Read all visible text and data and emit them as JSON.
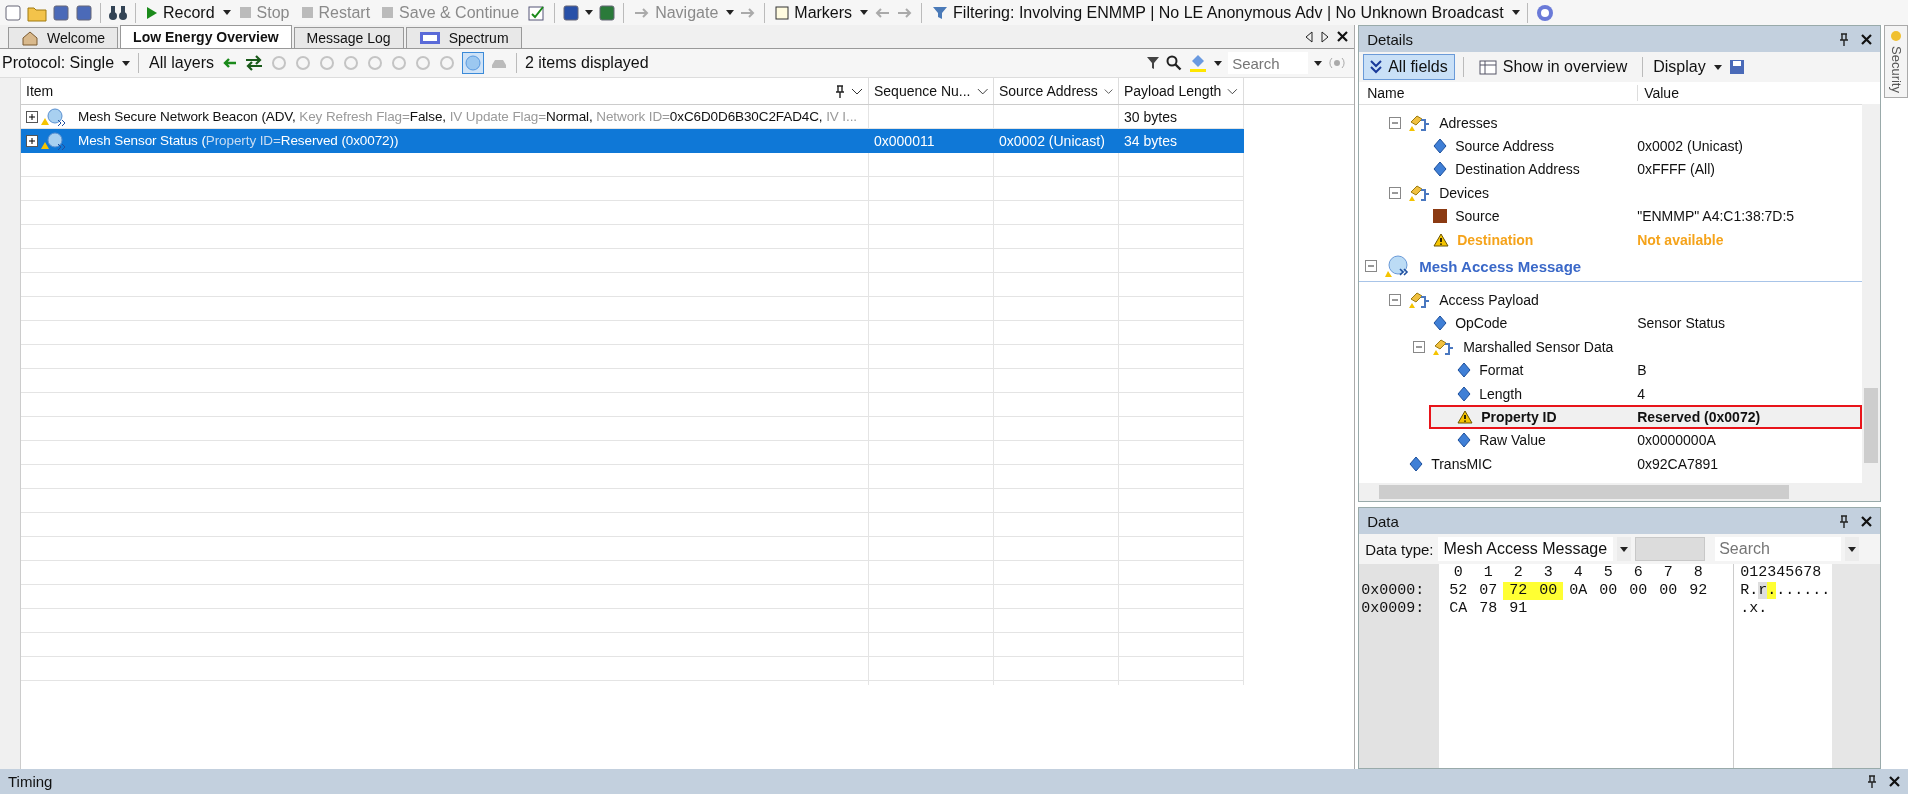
{
  "toolbar": {
    "buttons": [
      {
        "label": "Record",
        "disabled": false,
        "dropdown": true
      },
      {
        "label": "Stop",
        "disabled": true,
        "dropdown": false
      },
      {
        "label": "Restart",
        "disabled": true,
        "dropdown": false
      },
      {
        "label": "Save & Continue",
        "disabled": true,
        "dropdown": false
      },
      {
        "label": "Navigate",
        "disabled": true,
        "dropdown": true
      },
      {
        "label": "Markers",
        "disabled": false,
        "dropdown": true
      },
      {
        "label": "Filtering: Involving ENMMP | No LE Anonymous Adv | No Unknown Broadcast",
        "disabled": false,
        "dropdown": true
      }
    ]
  },
  "tabs": [
    {
      "label": "Welcome",
      "selected": false
    },
    {
      "label": "Low Energy Overview",
      "selected": true
    },
    {
      "label": "Message Log",
      "selected": false
    },
    {
      "label": "Spectrum",
      "selected": false
    }
  ],
  "filter_bar": {
    "protocol": "Protocol: Single",
    "layers": "All layers",
    "count": "2 items displayed",
    "search": {
      "placeholder": "Search"
    }
  },
  "table": {
    "columns": [
      "Item",
      "Sequence Nu...",
      "Source Address",
      "Payload Length"
    ],
    "rows": [
      {
        "item": [
          {
            "text": "Mesh Secure Network Beacon (ADV, ",
            "dim": false
          },
          {
            "text": "Key Refresh Flag=",
            "dim": true
          },
          {
            "text": "False, ",
            "dim": false
          },
          {
            "text": "IV Update Flag=",
            "dim": true
          },
          {
            "text": "Normal, ",
            "dim": false
          },
          {
            "text": "Network ID=",
            "dim": true
          },
          {
            "text": "0xC6D0D6B30C2FAD4C, ",
            "dim": false
          },
          {
            "text": "IV I...",
            "dim": true
          }
        ],
        "sequence": "",
        "source": "",
        "payload": "30 bytes",
        "selected": false
      },
      {
        "item": [
          {
            "text": "Mesh Sensor Status (",
            "dim": false
          },
          {
            "text": "Property ID=",
            "dim": true
          },
          {
            "text": "Reserved (0x0072))",
            "dim": false
          }
        ],
        "sequence": "0x000011",
        "source": "0x0002 (Unicast)",
        "payload": "34 bytes",
        "selected": true
      }
    ]
  },
  "details": {
    "title": "Details",
    "buttons": [
      {
        "label": "All fields",
        "selected": true
      },
      {
        "label": "Show in overview",
        "selected": false
      }
    ],
    "display": "Display",
    "columns": [
      "Name",
      "Value"
    ],
    "tree": [
      {
        "children": [
          {
            "label": "Adresses",
            "kind": "group",
            "expanded": true,
            "children": [
              {
                "label": "Source Address",
                "value": "0x0002 (Unicast)",
                "kind": "field"
              },
              {
                "label": "Destination Address",
                "value": "0xFFFF (All)",
                "kind": "field"
              }
            ]
          },
          {
            "label": "Devices",
            "kind": "group",
            "expanded": true,
            "children": [
              {
                "label": "Source",
                "value": "\"ENMMP\" A4:C1:38:7D:5",
                "kind": "device",
                "color": "#8b3a12"
              },
              {
                "label": "Destination",
                "value": "Not available",
                "kind": "missing"
              }
            ]
          }
        ]
      },
      {
        "label": "Mesh Access Message",
        "kind": "section",
        "expanded": true,
        "children": [
          {
            "label": "Access Payload",
            "kind": "group",
            "expanded": true,
            "children": [
              {
                "label": "OpCode",
                "value": "Sensor Status",
                "kind": "field"
              },
              {
                "label": "Marshalled Sensor Data",
                "kind": "group",
                "expanded": true,
                "children": [
                  {
                    "label": "Format",
                    "value": "B",
                    "kind": "field"
                  },
                  {
                    "label": "Length",
                    "value": "4",
                    "kind": "field"
                  },
                  {
                    "label": "Property ID",
                    "value": "Reserved (0x0072)",
                    "kind": "warning",
                    "highlighted": true
                  },
                  {
                    "label": "Raw Value",
                    "value": "0x0000000A",
                    "kind": "field"
                  }
                ]
              }
            ]
          },
          {
            "label": "TransMIC",
            "value": "0x92CA7891",
            "kind": "field"
          }
        ]
      }
    ]
  },
  "data": {
    "title": "Data",
    "type_label": "Data type:",
    "type_value": "Mesh Access Message",
    "search": {
      "placeholder": "Search"
    },
    "columns": [
      "0",
      "1",
      "2",
      "3",
      "4",
      "5",
      "6",
      "7",
      "8"
    ],
    "ascii_header": "012345678",
    "rows": [
      {
        "offset": "0x0000:",
        "bytes": [
          {
            "text": "52",
            "highlighted": false
          },
          {
            "text": "07",
            "highlighted": false
          },
          {
            "text": "72",
            "highlighted": true
          },
          {
            "text": "00",
            "highlighted": true
          },
          {
            "text": "0A",
            "highlighted": false
          },
          {
            "text": "00",
            "highlighted": false
          },
          {
            "text": "00",
            "highlighted": false
          },
          {
            "text": "00",
            "highlighted": false
          },
          {
            "text": "92",
            "highlighted": false
          }
        ],
        "ascii": [
          {
            "text": "R.",
            "cursor": false,
            "highlighted": false
          },
          {
            "text": "r",
            "cursor": true,
            "highlighted": false
          },
          {
            "text": ".",
            "cursor": false,
            "highlighted": true
          },
          {
            "text": "......",
            "cursor": false,
            "highlighted": false
          }
        ]
      },
      {
        "offset": "0x0009:",
        "bytes": [
          {
            "text": "CA",
            "highlighted": false
          },
          {
            "text": "78",
            "highlighted": false
          },
          {
            "text": "91",
            "highlighted": false
          }
        ],
        "ascii": [
          {
            "text": ".x.",
            "cursor": false,
            "highlighted": false
          }
        ]
      }
    ]
  },
  "side_tab": "Security",
  "timing": {
    "title": "Timing"
  }
}
